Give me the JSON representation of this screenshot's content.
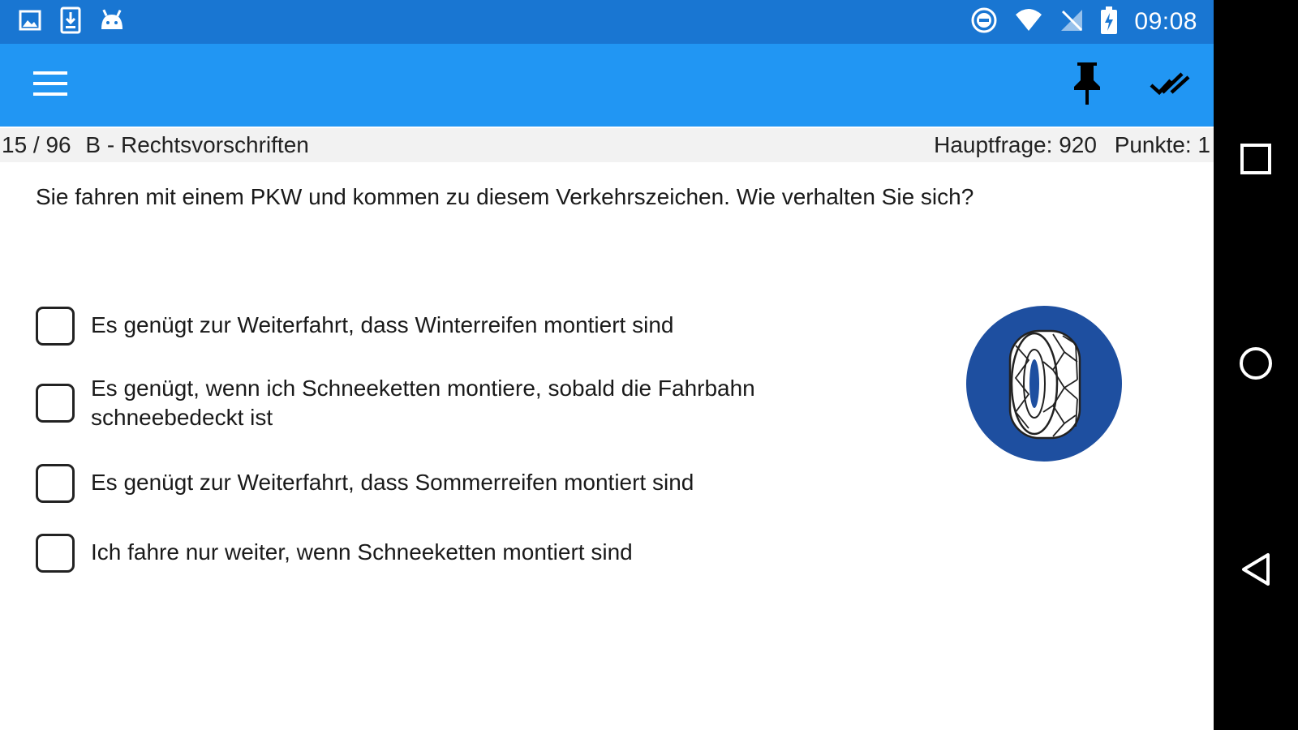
{
  "status_bar": {
    "time": "09:08",
    "left_icons": [
      "image-icon",
      "download-icon",
      "android-icon"
    ],
    "right_icons": [
      "do-not-disturb-icon",
      "wifi-icon",
      "no-sim-icon",
      "battery-charging-icon"
    ]
  },
  "toolbar": {
    "menu_icon": "hamburger-menu-icon",
    "pin_icon": "pushpin-icon",
    "check_icon": "done-all-icon",
    "color": "#2196f3"
  },
  "info_bar": {
    "progress": "15 / 96",
    "category": "B - Rechtsvorschriften",
    "main_question": "Hauptfrage: 920",
    "points": "Punkte: 1"
  },
  "question": {
    "text": "Sie fahren mit einem PKW und kommen zu diesem Verkehrszeichen. Wie verhalten Sie sich?"
  },
  "answers": [
    {
      "text": "Es genügt zur Weiterfahrt, dass Winterreifen montiert sind",
      "checked": false
    },
    {
      "text": "Es genügt, wenn ich Schneeketten montiere, sobald die Fahrbahn schneebedeckt ist",
      "checked": false
    },
    {
      "text": "Es genügt zur Weiterfahrt, dass Sommerreifen montiert sind",
      "checked": false
    },
    {
      "text": "Ich fahre nur weiter, wenn Schneeketten montiert sind",
      "checked": false
    }
  ],
  "sign": {
    "icon": "snow-chains-mandatory-sign-icon",
    "color": "#1e4fa0"
  },
  "nav_bar": {
    "icons": [
      "recents-icon",
      "home-icon",
      "back-icon"
    ]
  }
}
